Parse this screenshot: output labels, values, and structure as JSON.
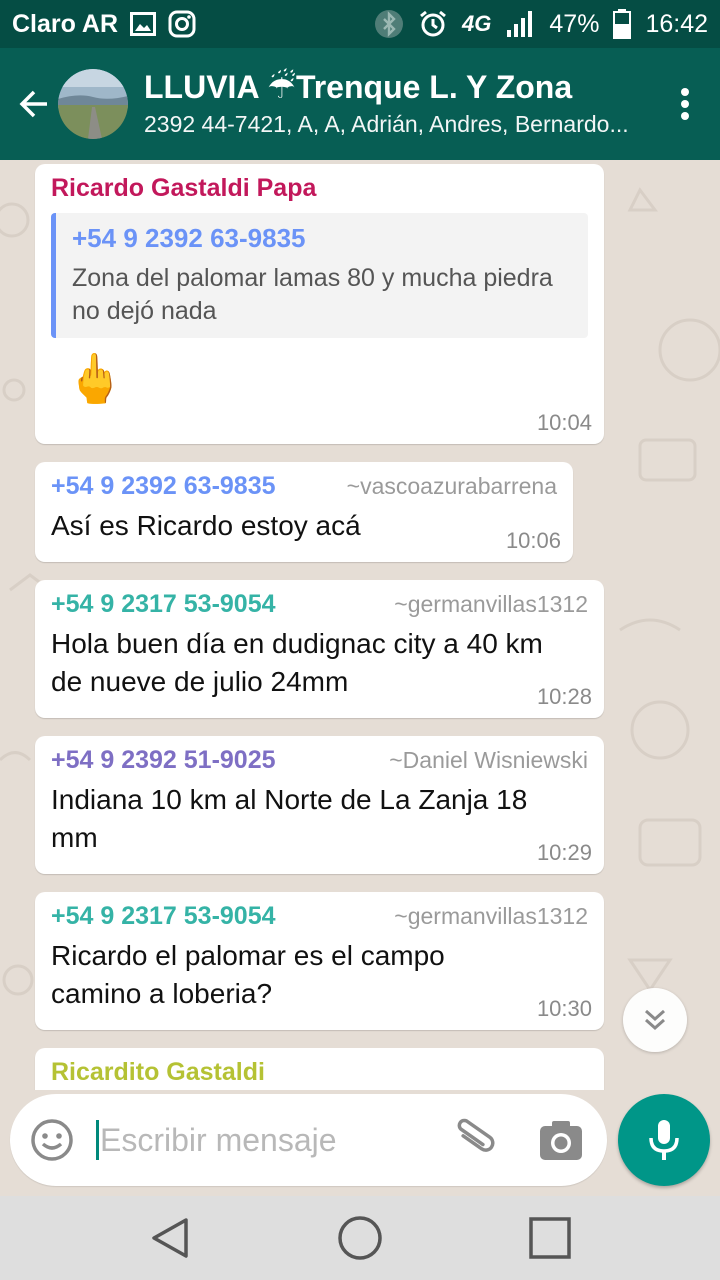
{
  "status_bar": {
    "carrier": "Claro AR",
    "network": "4G",
    "battery": "47%",
    "time": "16:42",
    "icons": [
      "image-icon",
      "instagram-icon",
      "bluetooth-icon",
      "alarm-icon",
      "signal-icon",
      "battery-icon"
    ]
  },
  "header": {
    "title": "LLUVIA ☔Trenque L. Y Zona",
    "members": "2392 44-7421, A, A, Adrián, Andres, Bernardo...",
    "back_icon": "arrow-left-icon",
    "menu_icon": "more-vert-icon"
  },
  "colors": {
    "header": "#075e54",
    "status_bar": "#054d44",
    "accent": "#009688",
    "quote_bar": "#6b93f7"
  },
  "messages": [
    {
      "sender": "Ricardo Gastaldi Papa",
      "sender_color": "#c2185b",
      "quote": {
        "sender": "+54 9 2392 63-9835",
        "text": "Zona del palomar lamas 80 y mucha piedra no dejó nada"
      },
      "text": "🖕",
      "time": "10:04"
    },
    {
      "sender": "+54 9 2392 63-9835",
      "sender_color": "#6b93f7",
      "alias": "~vascoazurabarrena",
      "text": "Así es Ricardo estoy acá",
      "time": "10:06"
    },
    {
      "sender": "+54 9 2317 53-9054",
      "sender_color": "#35b3a6",
      "alias": "~germanvillas1312",
      "text": "Hola buen día en dudignac city a 40 km de nueve de julio 24mm",
      "time": "10:28"
    },
    {
      "sender": "+54 9 2392 51-9025",
      "sender_color": "#7e6fc4",
      "alias": "~Daniel Wisniewski",
      "text": "Indiana 10 km al Norte de La Zanja 18 mm",
      "time": "10:29"
    },
    {
      "sender": "+54 9 2317 53-9054",
      "sender_color": "#35b3a6",
      "alias": "~germanvillas1312",
      "text": "Ricardo el palomar es el campo camino a loberia?",
      "time": "10:30"
    },
    {
      "sender": "Ricardito Gastaldi",
      "sender_color": "#b5c234"
    }
  ],
  "input": {
    "placeholder": "Escribir mensaje",
    "value": ""
  }
}
